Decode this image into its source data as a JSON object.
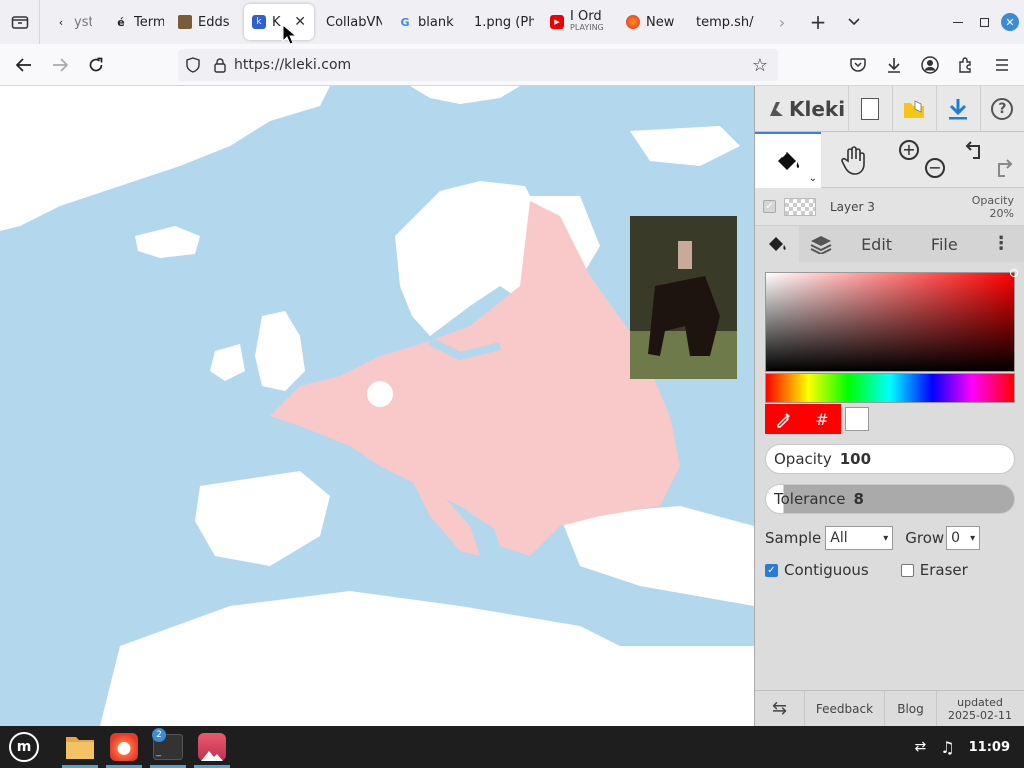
{
  "browser": {
    "tabs": [
      {
        "label": "yste",
        "icon": "back-chevron-icon"
      },
      {
        "label": "Term",
        "icon": "e-accent-icon"
      },
      {
        "label": "Edds",
        "icon": "image-favicon-icon"
      },
      {
        "label": "K",
        "icon": "kleki-favicon-icon",
        "active": true
      },
      {
        "label": "CollabVN",
        "icon": "none"
      },
      {
        "label": "blank",
        "icon": "google-icon"
      },
      {
        "label": "1.png (Ph",
        "icon": "none"
      },
      {
        "label": "I Ord",
        "sublabel": "PLAYING",
        "icon": "youtube-icon"
      },
      {
        "label": "New",
        "icon": "firefox-icon"
      },
      {
        "label": "temp.sh/",
        "icon": "none"
      }
    ],
    "url": "https://kleki.com",
    "colors": {
      "accent": "#0060df",
      "tabbar_bg": "#f0f0f4"
    }
  },
  "kleki": {
    "logo_text": "Kleki",
    "layer": {
      "name": "Layer 3",
      "opacity_label": "Opacity",
      "opacity_value": "20%"
    },
    "tabs": {
      "edit": "Edit",
      "file": "File"
    },
    "color": {
      "primary": "#ff0000",
      "secondary": "#ffffff",
      "hex_label": "#"
    },
    "opacity": {
      "label": "Opacity",
      "value": "100",
      "fraction": 1.0
    },
    "tolerance": {
      "label": "Tolerance",
      "value": "8",
      "fraction": 0.03
    },
    "sample": {
      "label": "Sample",
      "value": "All"
    },
    "grow": {
      "label": "Grow",
      "value": "0"
    },
    "contiguous": {
      "label": "Contiguous",
      "checked": true
    },
    "eraser": {
      "label": "Eraser",
      "checked": false
    },
    "footer": {
      "feedback": "Feedback",
      "blog": "Blog",
      "updated_label": "updated",
      "updated_date": "2025-02-11"
    }
  },
  "taskbar": {
    "terminal_badge": "2",
    "clock": "11:09"
  }
}
